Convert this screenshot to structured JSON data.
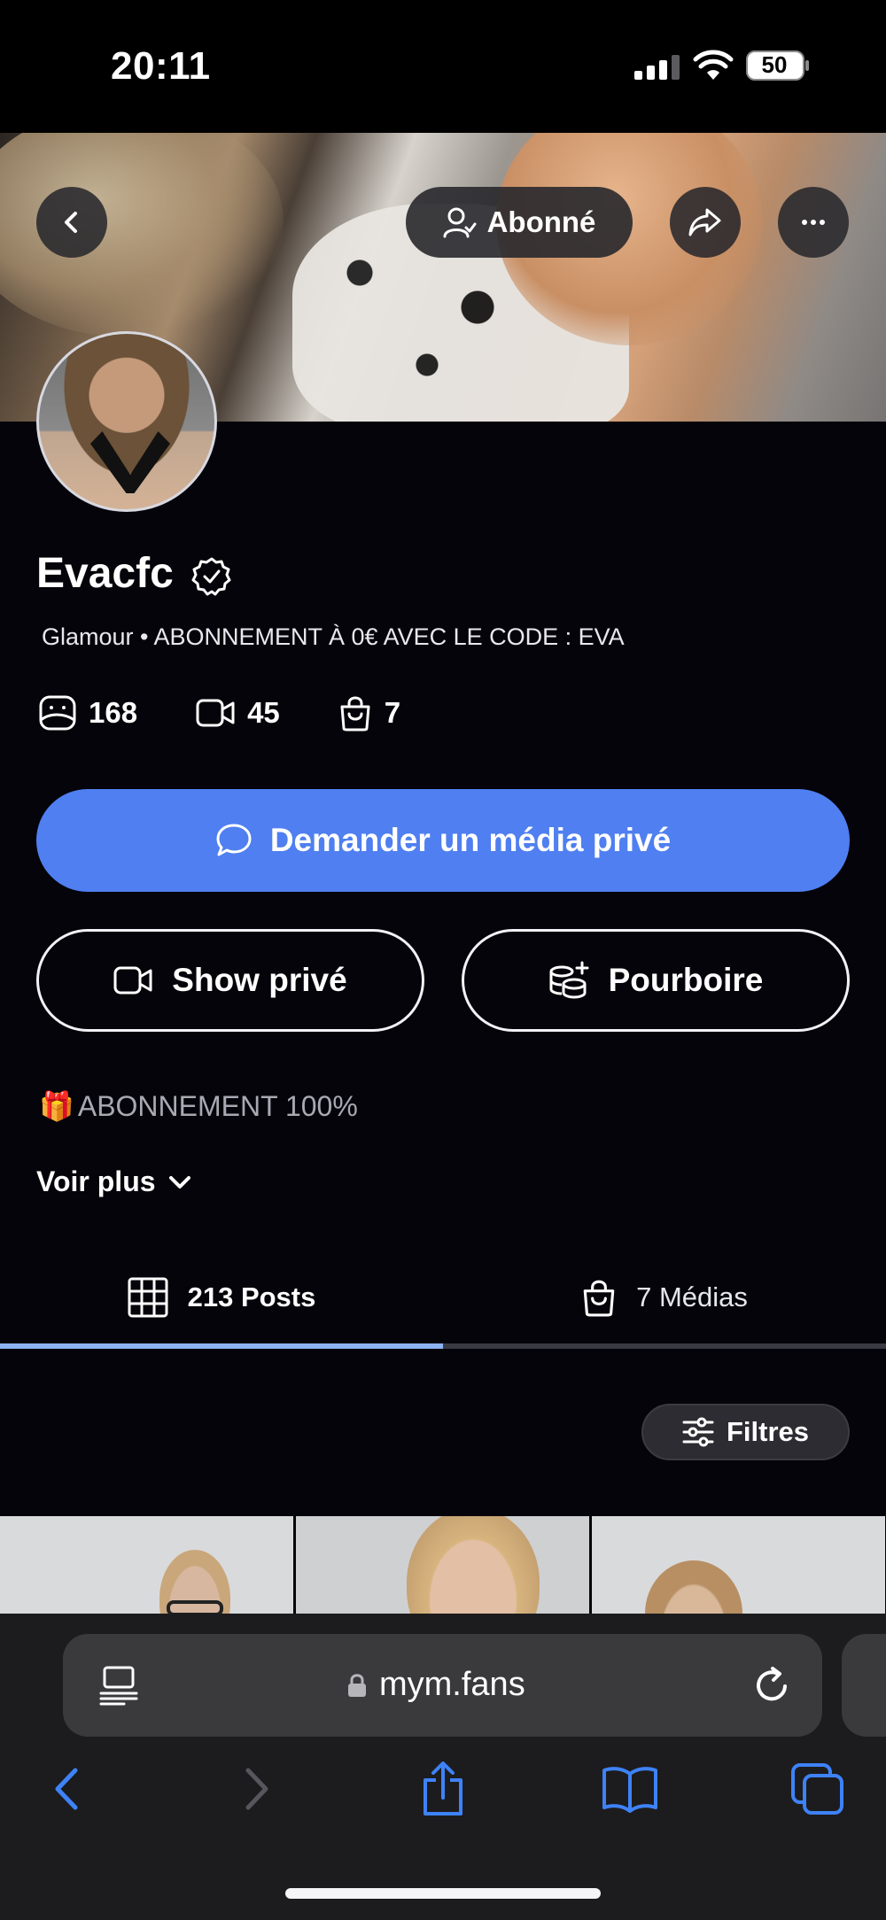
{
  "status_bar": {
    "time": "20:11",
    "battery_level": "50",
    "icons": [
      "signal-icon",
      "wifi-icon",
      "battery-icon"
    ]
  },
  "header": {
    "follow_label": "Abonné",
    "icons": [
      "back-icon",
      "user-check-icon",
      "share-icon",
      "more-icon"
    ]
  },
  "profile": {
    "name": "Evacfc",
    "verified": true,
    "bio": "Glamour • ABONNEMENT À 0€ AVEC LE CODE : EVA",
    "stats": [
      {
        "icon": "image-icon",
        "value": "168"
      },
      {
        "icon": "video-icon",
        "value": "45"
      },
      {
        "icon": "bag-icon",
        "value": "7"
      }
    ]
  },
  "actions": {
    "private_media_label": "Demander un média privé",
    "private_show_label": "Show privé",
    "tip_label": "Pourboire",
    "accent_color": "#4f7ff0"
  },
  "description": {
    "promo_emoji": "🎁",
    "promo_text": "ABONNEMENT 100%",
    "see_more_label": "Voir plus"
  },
  "tabs": {
    "items": [
      {
        "label": "213 Posts",
        "icon": "grid-icon",
        "active": true
      },
      {
        "label": "7 Médias",
        "icon": "bag-icon",
        "active": false
      }
    ],
    "indicator_color": "#8db2f4"
  },
  "filters": {
    "label": "Filtres",
    "icon": "sliders-icon"
  },
  "browser": {
    "url": "mym.fans",
    "icons": [
      "reader-icon",
      "lock-icon",
      "reload-icon"
    ],
    "toolbar": [
      "back-icon",
      "forward-icon",
      "share-icon",
      "bookmarks-icon",
      "tabs-icon"
    ],
    "accent_color": "#3e82f7"
  }
}
